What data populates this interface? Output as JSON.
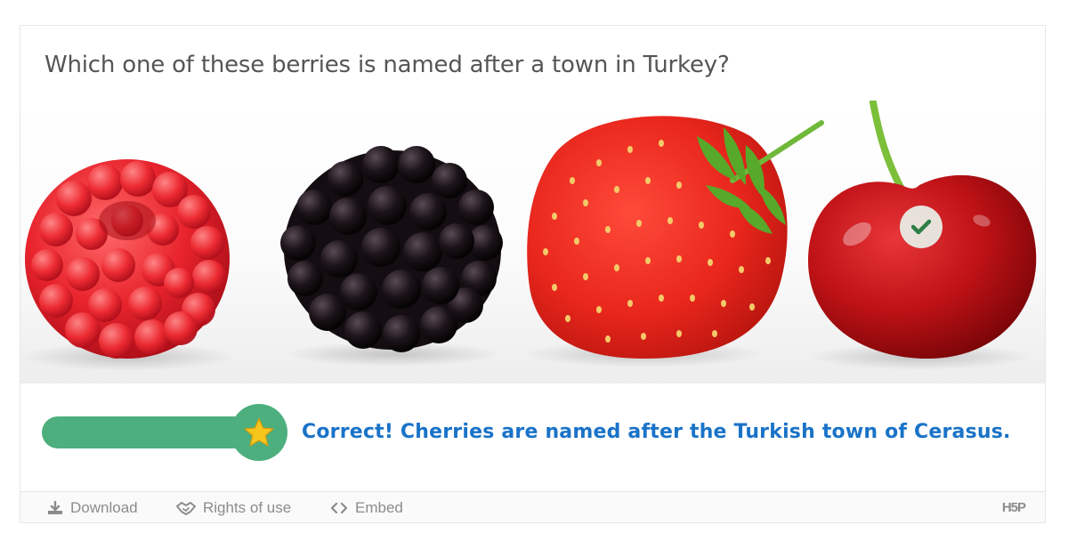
{
  "question": {
    "text": "Which one of these berries is named after a town in Turkey?"
  },
  "image": {
    "items": [
      "raspberry",
      "blackberry",
      "strawberry",
      "cherry"
    ],
    "selected_item": "cherry",
    "hotspot_icon": "checkmark-icon"
  },
  "result": {
    "score_fraction": 1.0,
    "score_icon": "star-icon",
    "feedback": "Correct! Cherries are named after the Turkish town of Cerasus."
  },
  "footer": {
    "download_label": "Download",
    "download_icon": "download-icon",
    "rights_label": "Rights of use",
    "rights_icon": "handshake-icon",
    "embed_label": "Embed",
    "embed_icon": "code-icon",
    "logo_text": "H5P"
  },
  "colors": {
    "question_text": "#555555",
    "progress_green": "#4caf7d",
    "feedback_blue": "#1a73c8",
    "star_yellow": "#f6c61c",
    "footer_text": "#8c8c8c"
  }
}
